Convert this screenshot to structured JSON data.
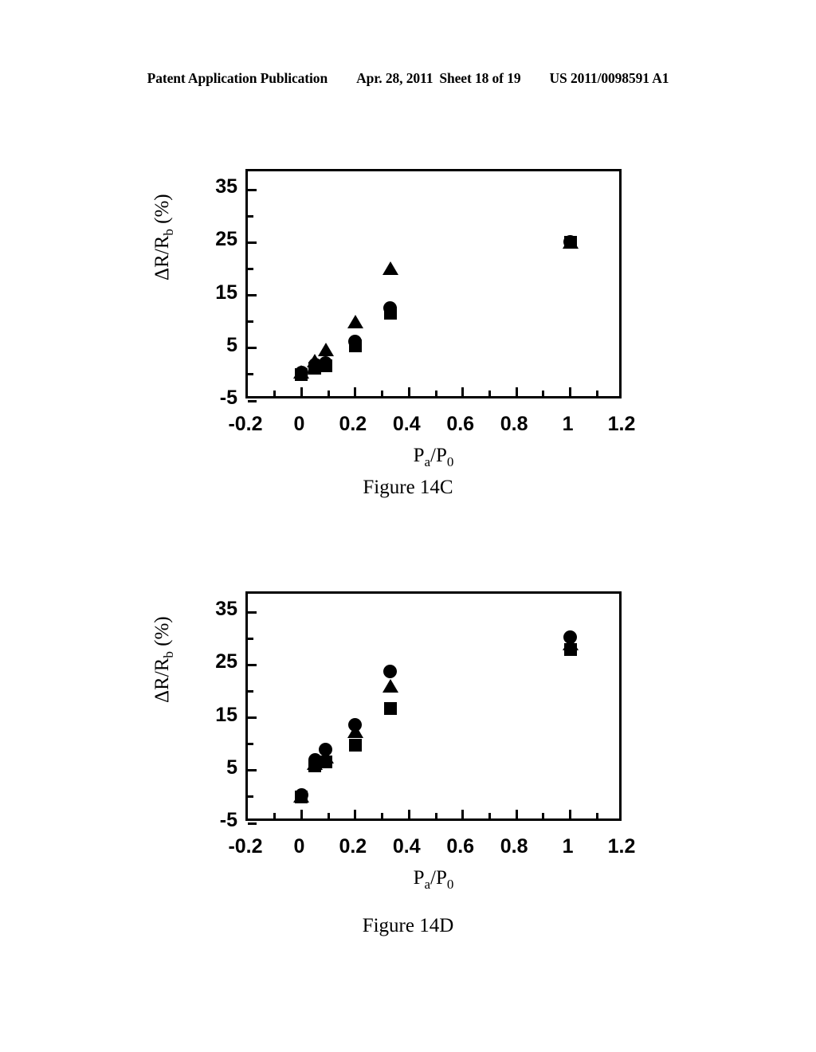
{
  "header": {
    "publication": "Patent Application Publication",
    "date": "Apr. 28, 2011",
    "sheet": "Sheet 18 of 19",
    "document_number": "US 2011/0098591 A1"
  },
  "figures": [
    {
      "id": "14C",
      "caption": "Figure 14C"
    },
    {
      "id": "14D",
      "caption": "Figure 14D"
    }
  ],
  "chart_data": [
    {
      "type": "scatter",
      "title": "Figure 14C",
      "xlabel": "Pa/P0",
      "xlabel_base": "P",
      "xlabel_sub1": "a",
      "xlabel_mid": "/P",
      "xlabel_sub2": "0",
      "ylabel": "ΔR/Rb (%)",
      "ylabel_base": "ΔR/R",
      "ylabel_sub": "b",
      "ylabel_unit": " (%)",
      "xlim": [
        -0.2,
        1.2
      ],
      "ylim": [
        -5,
        38.5
      ],
      "xticks": [
        "-0.2",
        "0",
        "0.2",
        "0.4",
        "0.6",
        "0.8",
        "1",
        "1.2"
      ],
      "xtick_values": [
        -0.2,
        0,
        0.2,
        0.4,
        0.6,
        0.8,
        1,
        1.2
      ],
      "xtick_minor_values": [
        -0.1,
        0.1,
        0.3,
        0.5,
        0.7,
        0.9,
        1.1
      ],
      "yticks": [
        "-5",
        "5",
        "15",
        "25",
        "35"
      ],
      "ytick_values": [
        -5,
        5,
        15,
        25,
        35
      ],
      "ytick_minor_values": [
        0,
        10,
        20,
        30
      ],
      "grid": false,
      "legend": false,
      "series": [
        {
          "name": "series-square",
          "marker": "square",
          "x": [
            0.0,
            0.05,
            0.09,
            0.2,
            0.33,
            1.0
          ],
          "y": [
            0.0,
            1.2,
            1.6,
            5.4,
            11.6,
            25.0
          ]
        },
        {
          "name": "series-circle",
          "marker": "circle",
          "x": [
            0.0,
            0.05,
            0.09,
            0.2,
            0.33,
            1.0
          ],
          "y": [
            0.3,
            1.8,
            2.2,
            6.3,
            12.6,
            25.2
          ]
        },
        {
          "name": "series-triangle",
          "marker": "triangle",
          "x": [
            0.0,
            0.05,
            0.09,
            0.2,
            0.33,
            1.0
          ],
          "y": [
            0.4,
            2.6,
            4.6,
            10.0,
            20.0,
            25.1
          ]
        }
      ]
    },
    {
      "type": "scatter",
      "title": "Figure 14D",
      "xlabel": "Pa/P0",
      "xlabel_base": "P",
      "xlabel_sub1": "a",
      "xlabel_mid": "/P",
      "xlabel_sub2": "0",
      "ylabel": "ΔR/Rb (%)",
      "ylabel_base": "ΔR/R",
      "ylabel_sub": "b",
      "ylabel_unit": " (%)",
      "xlim": [
        -0.2,
        1.2
      ],
      "ylim": [
        -5,
        38.5
      ],
      "xticks": [
        "-0.2",
        "0",
        "0.2",
        "0.4",
        "0.6",
        "0.8",
        "1",
        "1.2"
      ],
      "xtick_values": [
        -0.2,
        0,
        0.2,
        0.4,
        0.6,
        0.8,
        1,
        1.2
      ],
      "xtick_minor_values": [
        -0.1,
        0.1,
        0.3,
        0.5,
        0.7,
        0.9,
        1.1
      ],
      "yticks": [
        "-5",
        "5",
        "15",
        "25",
        "35"
      ],
      "ytick_values": [
        -5,
        5,
        15,
        25,
        35
      ],
      "ytick_minor_values": [
        0,
        10,
        20,
        30
      ],
      "grid": false,
      "legend": false,
      "series": [
        {
          "name": "series-square",
          "marker": "square",
          "x": [
            0.0,
            0.05,
            0.09,
            0.2,
            0.33,
            1.0
          ],
          "y": [
            0.0,
            5.8,
            6.6,
            9.8,
            16.8,
            28.0
          ]
        },
        {
          "name": "series-circle",
          "marker": "circle",
          "x": [
            0.0,
            0.05,
            0.09,
            0.2,
            0.33,
            1.0
          ],
          "y": [
            0.3,
            7.0,
            9.0,
            13.6,
            23.8,
            30.2
          ]
        },
        {
          "name": "series-triangle",
          "marker": "triangle",
          "x": [
            0.0,
            0.05,
            0.09,
            0.2,
            0.33,
            1.0
          ],
          "y": [
            0.2,
            6.4,
            7.6,
            12.4,
            21.0,
            29.0
          ]
        }
      ]
    }
  ]
}
